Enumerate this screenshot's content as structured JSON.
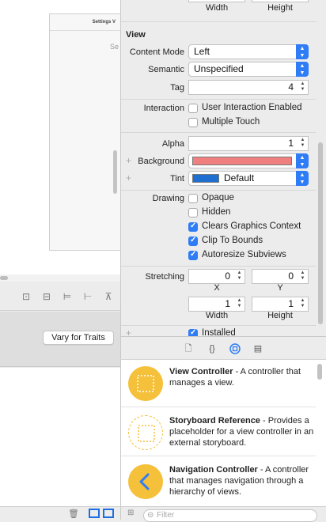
{
  "canvas": {
    "scene_title": "Settings V",
    "scene_partial_text": "Se"
  },
  "traits": {
    "vary_button": "Vary for Traits"
  },
  "inspector": {
    "size_top": {
      "width_label": "Width",
      "height_label": "Height"
    },
    "view_section_title": "View",
    "content_mode": {
      "label": "Content Mode",
      "value": "Left"
    },
    "semantic": {
      "label": "Semantic",
      "value": "Unspecified"
    },
    "tag": {
      "label": "Tag",
      "value": "4"
    },
    "interaction": {
      "label": "Interaction",
      "user_interaction": {
        "label": "User Interaction Enabled",
        "checked": false
      },
      "multiple_touch": {
        "label": "Multiple Touch",
        "checked": false
      }
    },
    "alpha": {
      "label": "Alpha",
      "value": "1"
    },
    "background": {
      "label": "Background",
      "color": "#f08080"
    },
    "tint": {
      "label": "Tint",
      "value": "Default",
      "color": "#1f6fd1"
    },
    "drawing": {
      "label": "Drawing",
      "opaque": {
        "label": "Opaque",
        "checked": false
      },
      "hidden": {
        "label": "Hidden",
        "checked": false
      },
      "clears_graphics": {
        "label": "Clears Graphics Context",
        "checked": true
      },
      "clip_to_bounds": {
        "label": "Clip To Bounds",
        "checked": true
      },
      "autoresize": {
        "label": "Autoresize Subviews",
        "checked": true
      }
    },
    "stretching": {
      "label": "Stretching",
      "x": "0",
      "y": "0",
      "width": "1",
      "height": "1",
      "x_label": "X",
      "y_label": "Y",
      "width_label": "Width",
      "height_label": "Height"
    },
    "installed": {
      "label": "Installed",
      "checked": true
    }
  },
  "library": {
    "items": [
      {
        "title": "View Controller",
        "desc": " - A controller that manages a view."
      },
      {
        "title": "Storyboard Reference",
        "desc": " - Provides a placeholder for a view controller in an external storyboard."
      },
      {
        "title": "Navigation Controller",
        "desc": " - A controller that manages navigation through a hierarchy of views."
      }
    ],
    "filter_placeholder": "Filter"
  },
  "colors": {
    "accent": "#2e7cf6",
    "object_yellow": "#f5c03a"
  }
}
